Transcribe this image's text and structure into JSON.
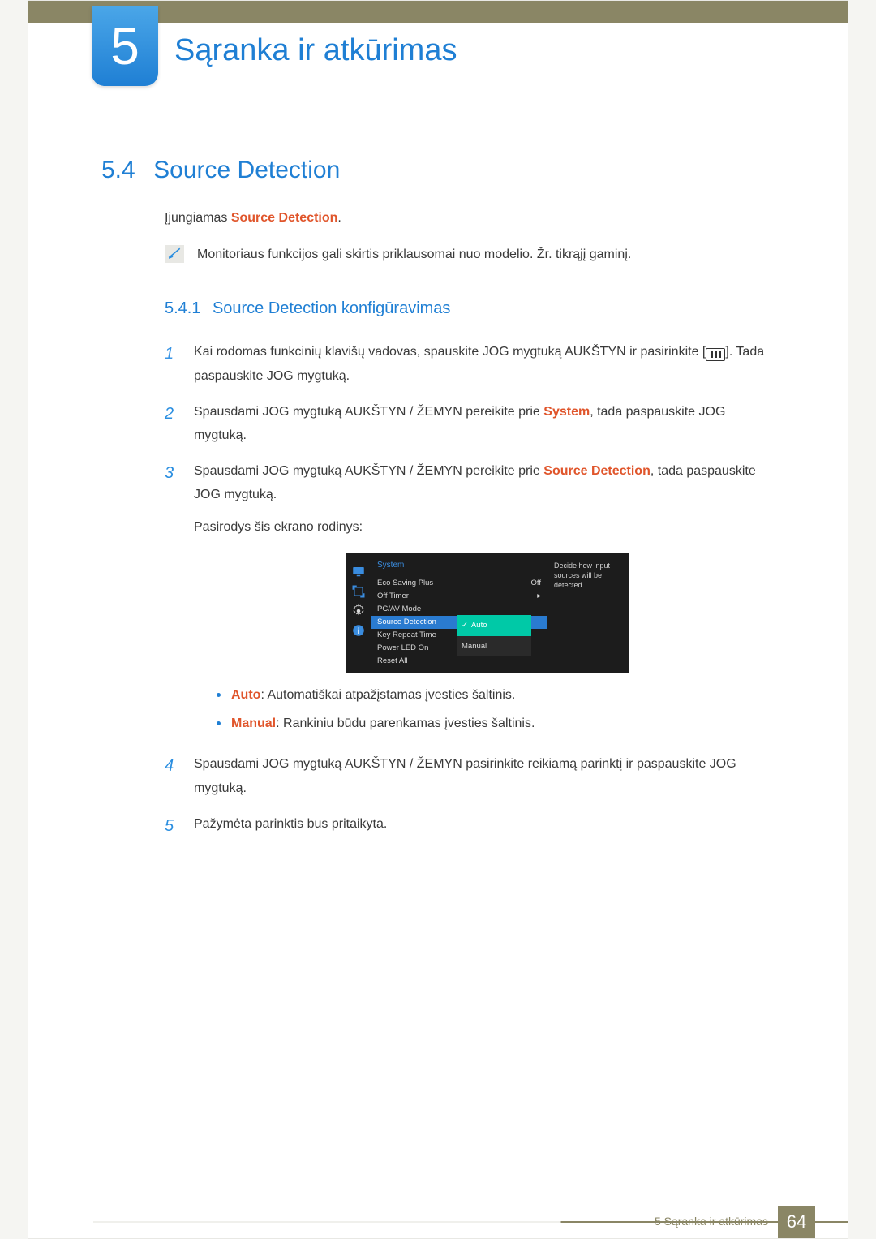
{
  "chapter": {
    "number": "5",
    "title": "Sąranka ir atkūrimas"
  },
  "section": {
    "number": "5.4",
    "title": "Source Detection"
  },
  "intro": {
    "prefix": "Įjungiamas ",
    "em": "Source Detection",
    "suffix": "."
  },
  "note": "Monitoriaus funkcijos gali skirtis priklausomai nuo modelio. Žr. tikrąjį gaminį.",
  "subsection": {
    "number": "5.4.1",
    "title": "Source Detection konfigūravimas"
  },
  "steps": {
    "s1": {
      "a": "Kai rodomas funkcinių klavišų vadovas, spauskite JOG mygtuką AUKŠTYN ir pasirinkite [",
      "b": "]. Tada paspauskite JOG mygtuką."
    },
    "s2": {
      "a": "Spausdami JOG mygtuką AUKŠTYN / ŽEMYN pereikite prie ",
      "em": "System",
      "b": ", tada paspauskite JOG mygtuką."
    },
    "s3": {
      "a": "Spausdami JOG mygtuką AUKŠTYN / ŽEMYN pereikite prie ",
      "em": "Source Detection",
      "b": ", tada paspauskite JOG mygtuką.",
      "c": "Pasirodys šis ekrano rodinys:"
    },
    "s4": "Spausdami JOG mygtuką AUKŠTYN / ŽEMYN pasirinkite reikiamą parinktį ir paspauskite JOG mygtuką.",
    "s5": "Pažymėta parinktis bus pritaikyta."
  },
  "osd": {
    "header": "System",
    "items": {
      "eco": {
        "label": "Eco Saving Plus",
        "value": "Off"
      },
      "offtimer": {
        "label": "Off Timer",
        "value": "▸"
      },
      "pcav": {
        "label": "PC/AV Mode",
        "value": ""
      },
      "source": {
        "label": "Source Detection",
        "value": ""
      },
      "keyrepeat": {
        "label": "Key Repeat Time",
        "value": ""
      },
      "powerled": {
        "label": "Power LED On",
        "value": ""
      },
      "reset": {
        "label": "Reset All",
        "value": ""
      }
    },
    "popup": {
      "auto": "Auto",
      "manual": "Manual",
      "check": "✓"
    },
    "help": "Decide how input sources will be detected."
  },
  "bullets": {
    "auto": {
      "em": "Auto",
      "text": ": Automatiškai atpažįstamas įvesties šaltinis."
    },
    "manual": {
      "em": "Manual",
      "text": ": Rankiniu būdu parenkamas įvesties šaltinis."
    }
  },
  "footer": {
    "chapter": "5 Sąranka ir atkūrimas",
    "page": "64"
  }
}
